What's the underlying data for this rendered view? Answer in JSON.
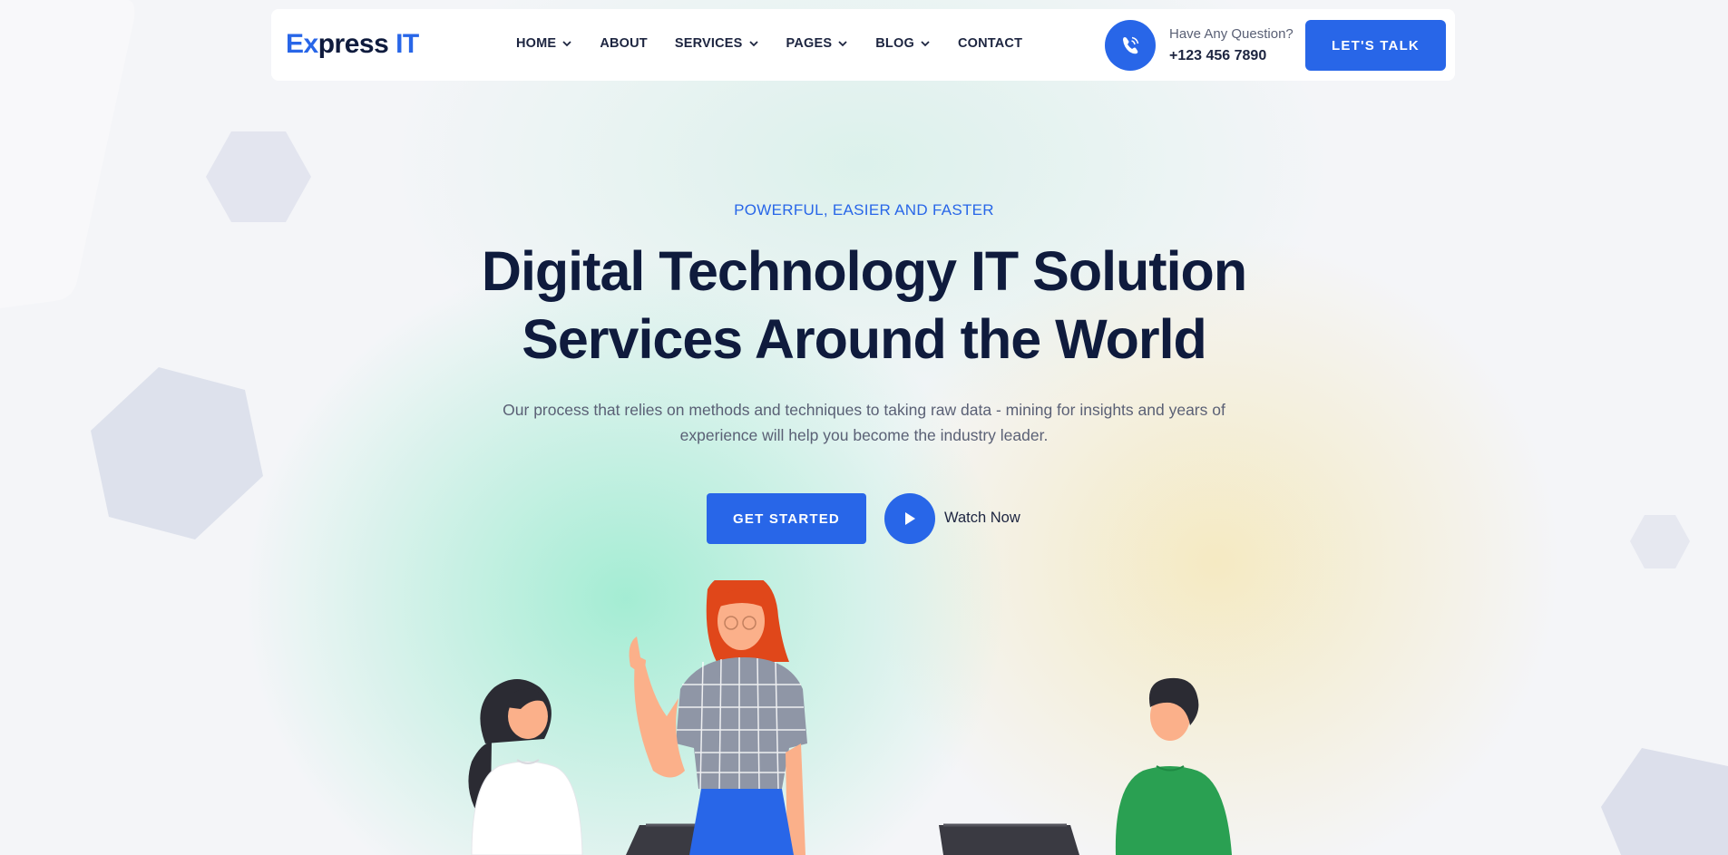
{
  "header": {
    "logo": {
      "part1": "Ex",
      "part2": "press ",
      "part3": "IT"
    },
    "nav": [
      {
        "label": "HOME",
        "has_dropdown": true
      },
      {
        "label": "ABOUT",
        "has_dropdown": false
      },
      {
        "label": "SERVICES",
        "has_dropdown": true
      },
      {
        "label": "PAGES",
        "has_dropdown": true
      },
      {
        "label": "BLOG",
        "has_dropdown": true
      },
      {
        "label": "CONTACT",
        "has_dropdown": false
      }
    ],
    "contact": {
      "icon": "phone-call-icon",
      "question": "Have Any Question?",
      "phone": "+123 456 7890"
    },
    "cta_label": "LET'S TALK"
  },
  "hero": {
    "eyebrow": "POWERFUL, EASIER AND FASTER",
    "title_line1": "Digital Technology IT Solution",
    "title_line2": "Services Around the World",
    "description_line1": "Our process that relies on methods and techniques to taking raw data - mining for insights and years of",
    "description_line2": "experience will help you become the industry leader.",
    "primary_button": "GET STARTED",
    "video_button_icon": "play-icon",
    "video_label": "Watch Now"
  },
  "colors": {
    "accent": "#2866e8",
    "heading": "#0f1b3d",
    "body_text": "#5a6075",
    "background": "#f4f5f8"
  }
}
